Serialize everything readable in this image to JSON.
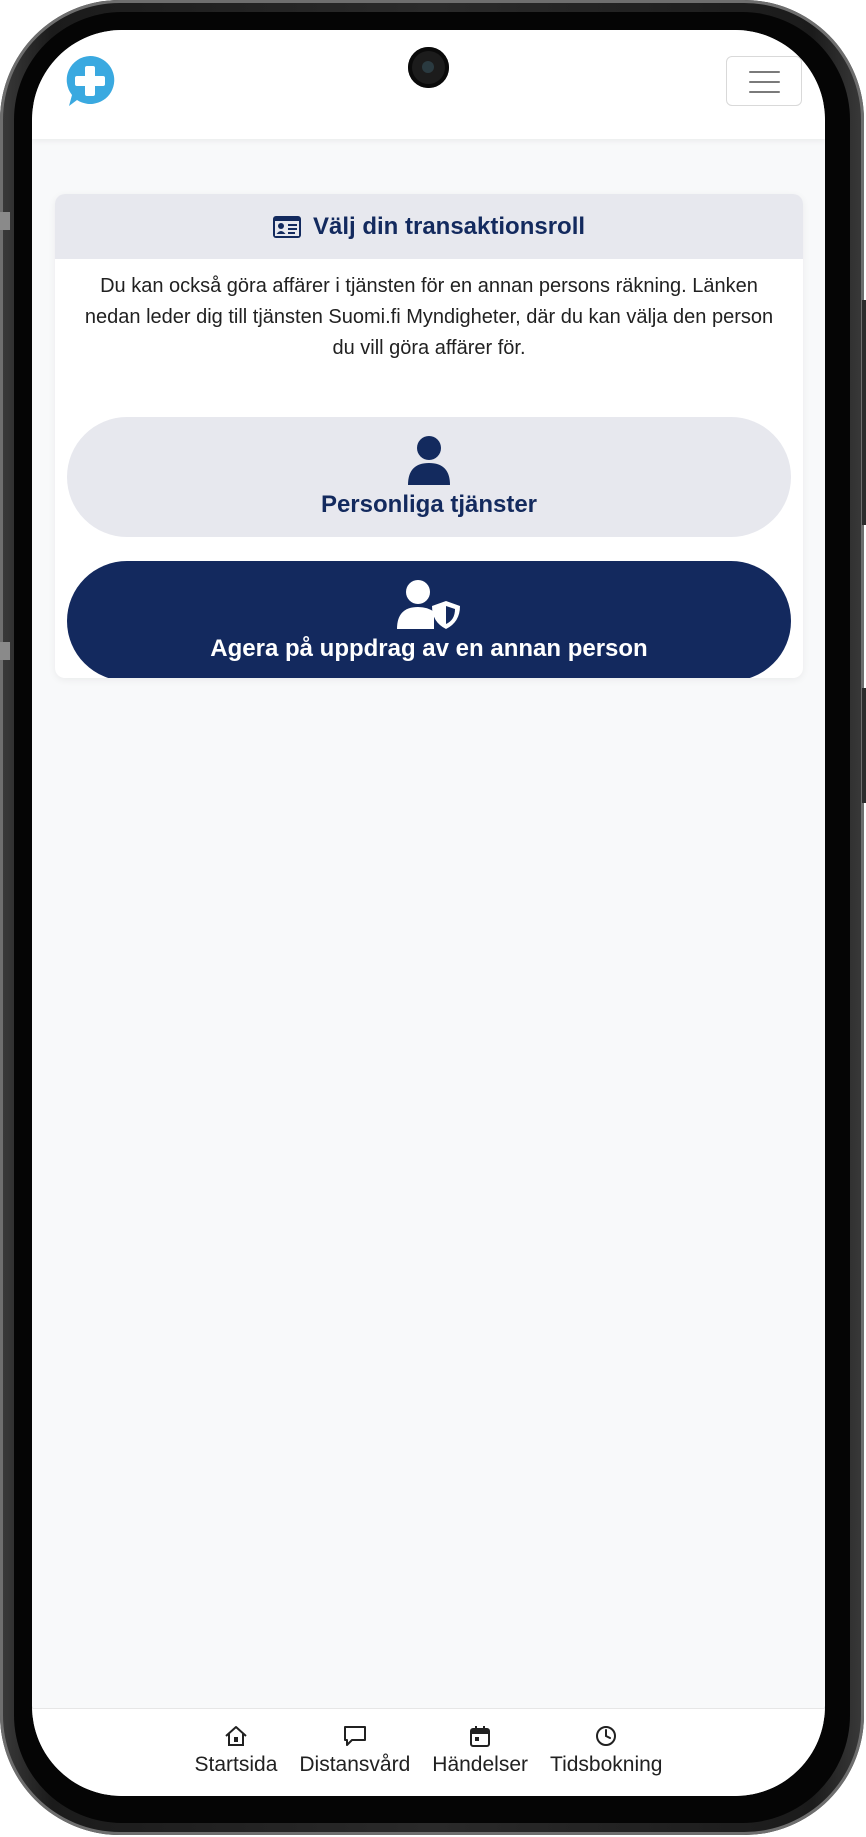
{
  "header": {
    "logo_icon": "medical-cross-chat-bubble-icon",
    "menu_icon": "hamburger-menu-icon",
    "brand_color": "#3aa9e0"
  },
  "role_card": {
    "title": "Välj din transaktionsroll",
    "title_icon": "id-card-icon",
    "description": "Du kan också göra affärer i tjänsten för en annan persons räkning. Länken nedan leder dig till tjänsten Suomi.fi Myndigheter, där du kan välja den person du vill göra affärer för.",
    "options": [
      {
        "label": "Personliga tjänster",
        "icon": "user-icon",
        "selected": false
      },
      {
        "label": "Agera på uppdrag av en annan person",
        "icon": "user-shield-icon",
        "selected": true
      }
    ]
  },
  "bottom_nav": {
    "items": [
      {
        "label": "Startsida",
        "icon": "home-icon"
      },
      {
        "label": "Distansvård",
        "icon": "chat-icon"
      },
      {
        "label": "Händelser",
        "icon": "calendar-icon"
      },
      {
        "label": "Tidsbokning",
        "icon": "clock-icon"
      }
    ]
  },
  "colors": {
    "primary": "#13295e",
    "header_bg": "#e7e8ee",
    "page_bg": "#f8f9fa"
  }
}
